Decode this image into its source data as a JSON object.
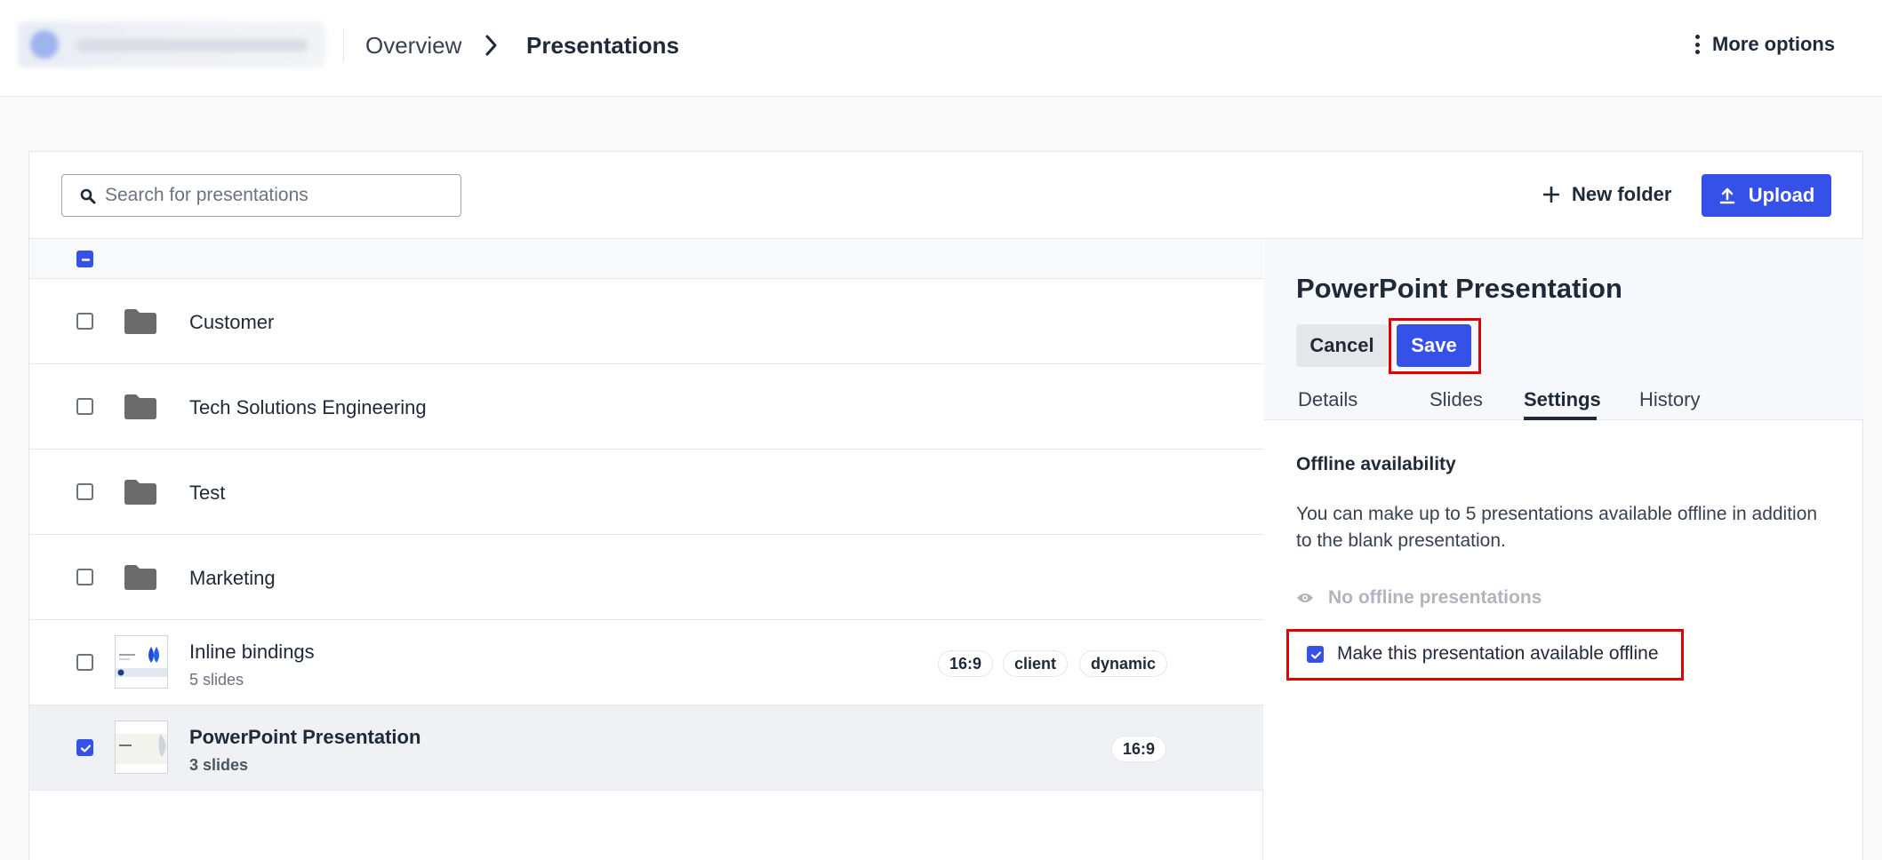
{
  "header": {
    "breadcrumb": {
      "overview": "Overview",
      "current": "Presentations"
    },
    "more_options": "More options"
  },
  "toolbar": {
    "search_placeholder": "Search for presentations",
    "new_folder": "New folder",
    "upload": "Upload"
  },
  "list": {
    "items": [
      {
        "type": "folder",
        "name": "Customer",
        "checked": false
      },
      {
        "type": "folder",
        "name": "Tech Solutions Engineering",
        "checked": false
      },
      {
        "type": "folder",
        "name": "Test",
        "checked": false
      },
      {
        "type": "folder",
        "name": "Marketing",
        "checked": false
      },
      {
        "type": "presentation",
        "name": "Inline bindings",
        "subtitle": "5 slides",
        "tags": [
          "16:9",
          "client",
          "dynamic"
        ],
        "checked": false
      },
      {
        "type": "presentation",
        "name": "PowerPoint Presentation",
        "subtitle": "3 slides",
        "tags": [
          "16:9"
        ],
        "checked": true,
        "selected": true
      }
    ]
  },
  "panel": {
    "title": "PowerPoint Presentation",
    "cancel": "Cancel",
    "save": "Save",
    "tabs": [
      {
        "label": "Details",
        "active": false
      },
      {
        "label": "Slides",
        "active": false
      },
      {
        "label": "Settings",
        "active": true
      },
      {
        "label": "History",
        "active": false
      }
    ],
    "settings": {
      "section_title": "Offline availability",
      "description": "You can make up to 5 presentations available offline in addition to the blank presentation.",
      "no_offline": "No offline presentations",
      "offline_checkbox_label": "Make this presentation available offline",
      "offline_checked": true
    }
  },
  "colors": {
    "accent": "#3651e8",
    "highlight_outline": "#e00000",
    "folder": "#6b6b6b"
  }
}
